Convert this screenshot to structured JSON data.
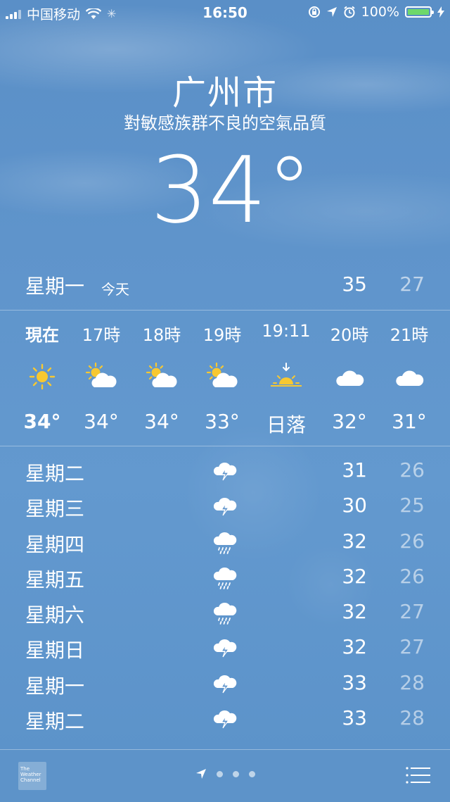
{
  "status_bar": {
    "carrier": "中国移动",
    "time": "16:50",
    "battery": "100%"
  },
  "location": {
    "city": "广州市",
    "condition": "對敏感族群不良的空氣品質",
    "temperature": "34°"
  },
  "today": {
    "day": "星期一",
    "label": "今天",
    "high": "35",
    "low": "27"
  },
  "hourly": [
    {
      "label": "現在",
      "icon": "sun-icon",
      "temp": "34°"
    },
    {
      "label": "17時",
      "icon": "partly-cloudy-icon",
      "temp": "34°"
    },
    {
      "label": "18時",
      "icon": "partly-cloudy-icon",
      "temp": "34°"
    },
    {
      "label": "19時",
      "icon": "partly-cloudy-icon",
      "temp": "33°"
    },
    {
      "label": "19:11",
      "icon": "sunset-icon",
      "temp": "日落"
    },
    {
      "label": "20時",
      "icon": "cloud-icon",
      "temp": "32°"
    },
    {
      "label": "21時",
      "icon": "cloud-icon",
      "temp": "31°"
    }
  ],
  "daily": [
    {
      "day": "星期二",
      "icon": "thunderstorm-icon",
      "high": "31",
      "low": "26"
    },
    {
      "day": "星期三",
      "icon": "thunderstorm-icon",
      "high": "30",
      "low": "25"
    },
    {
      "day": "星期四",
      "icon": "rain-icon",
      "high": "32",
      "low": "26"
    },
    {
      "day": "星期五",
      "icon": "rain-icon",
      "high": "32",
      "low": "26"
    },
    {
      "day": "星期六",
      "icon": "rain-icon",
      "high": "32",
      "low": "27"
    },
    {
      "day": "星期日",
      "icon": "thunderstorm-icon",
      "high": "32",
      "low": "27"
    },
    {
      "day": "星期一",
      "icon": "thunderstorm-icon",
      "high": "33",
      "low": "28"
    },
    {
      "day": "星期二",
      "icon": "thunderstorm-icon",
      "high": "33",
      "low": "28"
    }
  ],
  "footer": {
    "logo_text": "The Weather Channel"
  },
  "colors": {
    "sun": "#f7c831",
    "battery": "#6dd86b",
    "background": "#5f94cb"
  }
}
